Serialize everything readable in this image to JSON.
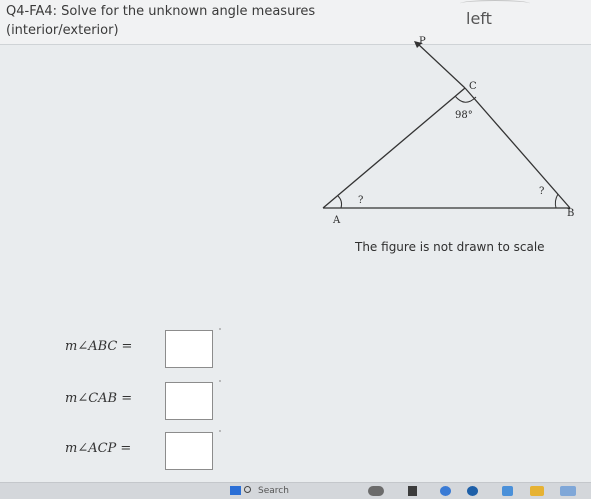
{
  "header": {
    "prompt_line1": "Q4-FA4: Solve for the unknown angle measures",
    "prompt_line2": "(interior/exterior)",
    "side_note": "left"
  },
  "figure": {
    "labels": {
      "P": "P",
      "C": "C",
      "A": "A",
      "B": "B"
    },
    "angle_C": "98°",
    "unknown_A": "?",
    "unknown_B": "?",
    "note": "The figure is not drawn to scale"
  },
  "answers": [
    {
      "expression": "m∠ABC =",
      "value": ""
    },
    {
      "expression": "m∠CAB =",
      "value": ""
    },
    {
      "expression": "m∠ACP =",
      "value": ""
    }
  ],
  "taskbar": {
    "search_label": "Search"
  }
}
